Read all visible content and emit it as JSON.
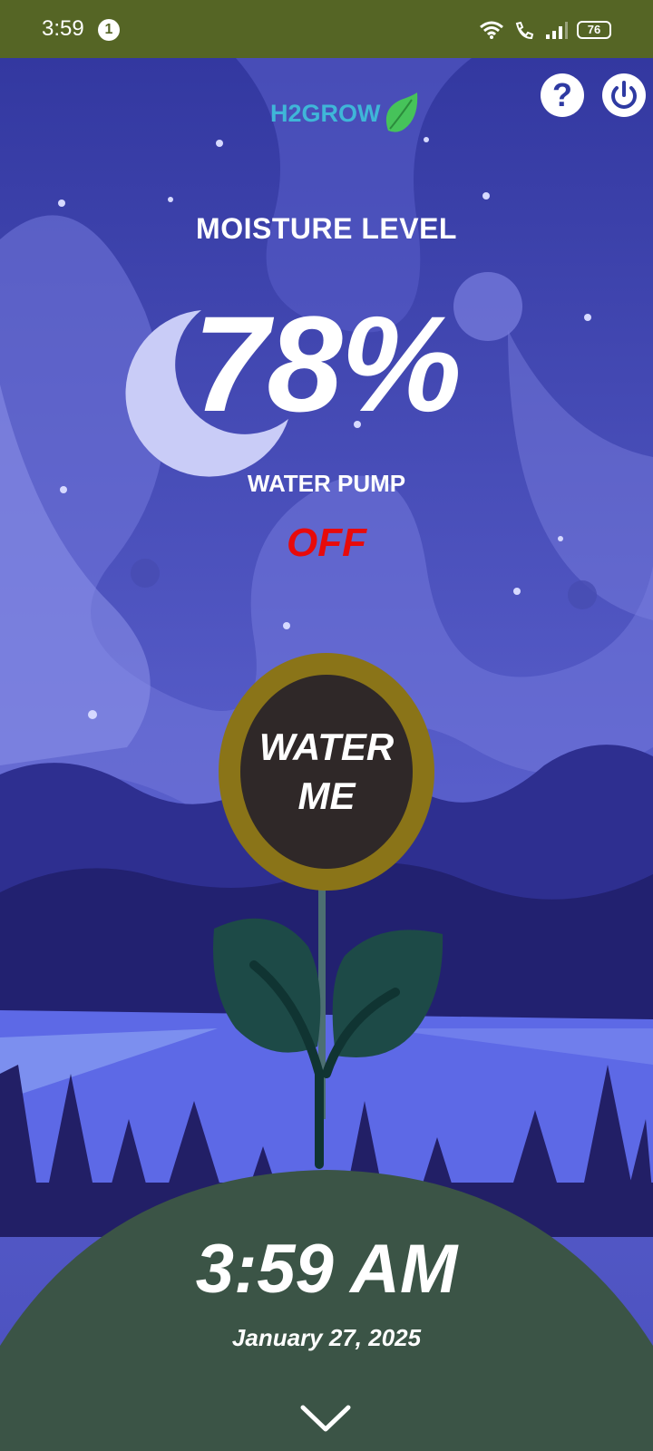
{
  "status_bar": {
    "time": "3:59",
    "notification_count": "1",
    "battery": "76"
  },
  "header": {
    "logo_text": "H2GROW",
    "help_label": "?"
  },
  "moisture": {
    "title": "MOISTURE LEVEL",
    "value": "78%"
  },
  "pump": {
    "label": "WATER PUMP",
    "status": "OFF",
    "status_color": "#e80a0a"
  },
  "water_button": {
    "label": "WATER ME"
  },
  "clock": {
    "time": "3:59 AM",
    "date": "January 27, 2025"
  },
  "icons": {
    "status": [
      "wifi-icon",
      "wifi-call-icon",
      "signal-icon",
      "battery-icon"
    ],
    "header": [
      "leaf-icon",
      "help-icon",
      "power-icon"
    ],
    "footer": [
      "chevron-down-icon"
    ]
  },
  "colors": {
    "status_bar": "#556525",
    "sky": "#3b3f9e",
    "ground": "#3b5446",
    "leaf": "#1d4a47",
    "button_ring": "#8a7418"
  }
}
